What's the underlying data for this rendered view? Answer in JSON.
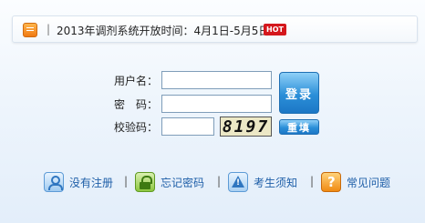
{
  "notice": {
    "separator": "|",
    "text": "2013年调剂系统开放时间：4月1日-5月5日",
    "badge": "HOT",
    "icon": "notice-icon"
  },
  "form": {
    "username_label": "用户名：",
    "password_label": "密　码：",
    "captcha_label": "校验码：",
    "username_value": "",
    "password_value": "",
    "captcha_value": "",
    "captcha_image_text": "8197",
    "login_button": "登录",
    "reset_button": "重填"
  },
  "links": [
    {
      "label": "没有注册",
      "icon": "user-icon"
    },
    {
      "label": "忘记密码",
      "icon": "lock-icon"
    },
    {
      "label": "考生须知",
      "icon": "warning-icon"
    },
    {
      "label": "常见问题",
      "icon": "help-icon"
    }
  ],
  "link_separator": "|",
  "colors": {
    "accent": "#2b8fd8",
    "link": "#1f5fa8",
    "hot": "#d4171c"
  }
}
